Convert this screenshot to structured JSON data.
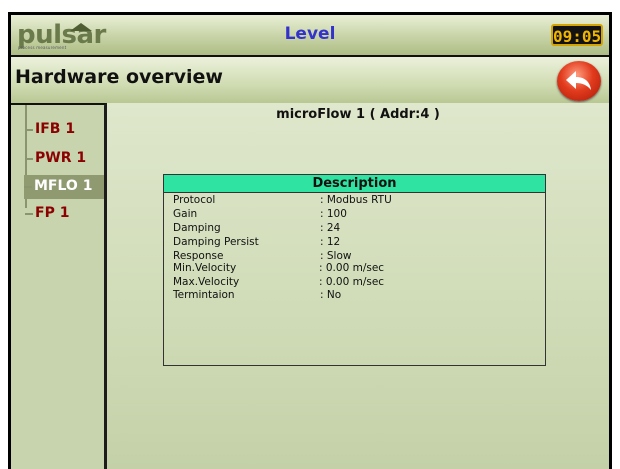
{
  "app": {
    "logo_text": "pulsar",
    "logo_tagline": "process measurement",
    "title": "Level",
    "clock": "09:05"
  },
  "header": {
    "title": "Hardware overview"
  },
  "sidebar": {
    "items": [
      {
        "label": "IFB 1",
        "selected": false
      },
      {
        "label": "PWR 1",
        "selected": false
      },
      {
        "label": "MFLO 1",
        "selected": true
      },
      {
        "label": "FP 1",
        "selected": false
      }
    ]
  },
  "main": {
    "device_heading": "microFlow 1 ( Addr:4 )",
    "description": {
      "title": "Description",
      "rows": [
        {
          "key": "Protocol",
          "value": ": Modbus RTU"
        },
        {
          "key": "Gain",
          "value": ": 100"
        },
        {
          "key": "Damping",
          "value": ": 24"
        },
        {
          "key": "Damping Persist",
          "value": ": 12"
        },
        {
          "key": "Response",
          "value": ": Slow"
        },
        {
          "key": "Min.Velocity",
          "value": ": 0.00 m/sec"
        },
        {
          "key": "Max.Velocity",
          "value": ": 0.00 m/sec"
        },
        {
          "key": "Termintaion",
          "value": ": No"
        }
      ]
    }
  },
  "icons": {
    "back": "back-arrow-icon",
    "logo_roof": "house-roof-icon"
  },
  "colors": {
    "title": "#3333cc",
    "sidebar_item": "#8b0000",
    "description_header": "#2fe3a3",
    "back_button": "#e23b1d",
    "clock_digits": "#f0b400"
  }
}
